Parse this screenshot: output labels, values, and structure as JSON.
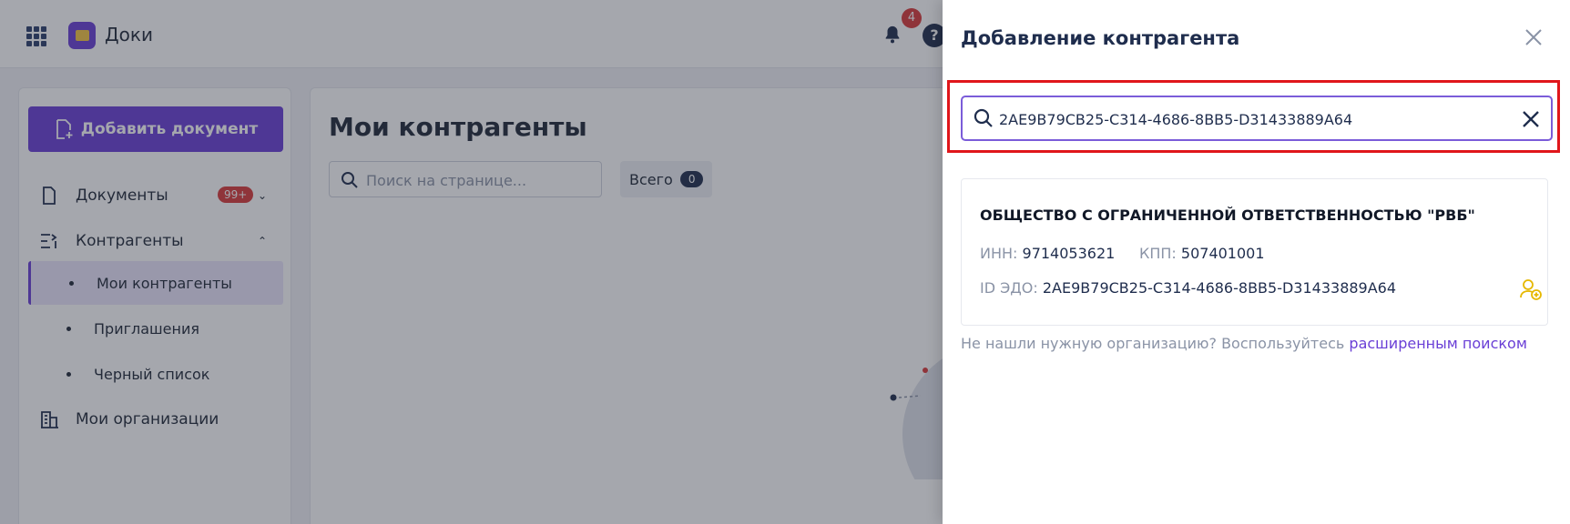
{
  "app": {
    "title": "Доки",
    "notifications_count": "4",
    "help_label": "?"
  },
  "sidebar": {
    "add_document_label": "Добавить документ",
    "items": [
      {
        "label": "Документы",
        "badge": "99+",
        "icon": "document-icon"
      },
      {
        "label": "Контрагенты",
        "icon": "counterparties-icon"
      },
      {
        "label": "Мои организации",
        "icon": "organization-icon"
      }
    ],
    "subitems": [
      {
        "label": "Мои контрагенты",
        "active": true
      },
      {
        "label": "Приглашения",
        "active": false
      },
      {
        "label": "Черный список",
        "active": false
      }
    ]
  },
  "main": {
    "title": "Мои контрагенты",
    "search_placeholder": "Поиск на странице...",
    "total_label": "Всего",
    "total_count": "0"
  },
  "drawer": {
    "title": "Добавление контрагента",
    "search_value": "2AE9B79CB25-C314-4686-8BB5-D31433889A64",
    "result": {
      "name": "ОБЩЕСТВО С ОГРАНИЧЕННОЙ ОТВЕТСТВЕННОСТЬЮ \"РВБ\"",
      "inn_label": "ИНН:",
      "inn": "9714053621",
      "kpp_label": "КПП:",
      "kpp": "507401001",
      "edo_label": "ID ЭДО:",
      "edo": "2AE9B79CB25-C314-4686-8BB5-D31433889A64"
    },
    "hint_text": "Не нашли нужную организацию? Воспользуйтесь",
    "hint_link": "расширенным поиском"
  },
  "colors": {
    "accent": "#6a3fd6",
    "badge_red": "#d93a3a",
    "highlight_red": "#e0161b",
    "dark_text": "#1f2d4d"
  }
}
